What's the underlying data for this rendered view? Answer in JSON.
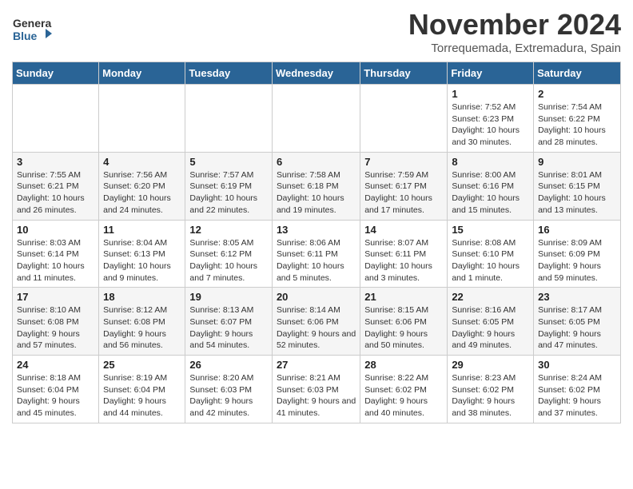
{
  "logo": {
    "line1": "General",
    "line2": "Blue"
  },
  "header": {
    "month": "November 2024",
    "location": "Torrequemada, Extremadura, Spain"
  },
  "weekdays": [
    "Sunday",
    "Monday",
    "Tuesday",
    "Wednesday",
    "Thursday",
    "Friday",
    "Saturday"
  ],
  "weeks": [
    [
      {
        "day": "",
        "info": ""
      },
      {
        "day": "",
        "info": ""
      },
      {
        "day": "",
        "info": ""
      },
      {
        "day": "",
        "info": ""
      },
      {
        "day": "",
        "info": ""
      },
      {
        "day": "1",
        "info": "Sunrise: 7:52 AM\nSunset: 6:23 PM\nDaylight: 10 hours and 30 minutes."
      },
      {
        "day": "2",
        "info": "Sunrise: 7:54 AM\nSunset: 6:22 PM\nDaylight: 10 hours and 28 minutes."
      }
    ],
    [
      {
        "day": "3",
        "info": "Sunrise: 7:55 AM\nSunset: 6:21 PM\nDaylight: 10 hours and 26 minutes."
      },
      {
        "day": "4",
        "info": "Sunrise: 7:56 AM\nSunset: 6:20 PM\nDaylight: 10 hours and 24 minutes."
      },
      {
        "day": "5",
        "info": "Sunrise: 7:57 AM\nSunset: 6:19 PM\nDaylight: 10 hours and 22 minutes."
      },
      {
        "day": "6",
        "info": "Sunrise: 7:58 AM\nSunset: 6:18 PM\nDaylight: 10 hours and 19 minutes."
      },
      {
        "day": "7",
        "info": "Sunrise: 7:59 AM\nSunset: 6:17 PM\nDaylight: 10 hours and 17 minutes."
      },
      {
        "day": "8",
        "info": "Sunrise: 8:00 AM\nSunset: 6:16 PM\nDaylight: 10 hours and 15 minutes."
      },
      {
        "day": "9",
        "info": "Sunrise: 8:01 AM\nSunset: 6:15 PM\nDaylight: 10 hours and 13 minutes."
      }
    ],
    [
      {
        "day": "10",
        "info": "Sunrise: 8:03 AM\nSunset: 6:14 PM\nDaylight: 10 hours and 11 minutes."
      },
      {
        "day": "11",
        "info": "Sunrise: 8:04 AM\nSunset: 6:13 PM\nDaylight: 10 hours and 9 minutes."
      },
      {
        "day": "12",
        "info": "Sunrise: 8:05 AM\nSunset: 6:12 PM\nDaylight: 10 hours and 7 minutes."
      },
      {
        "day": "13",
        "info": "Sunrise: 8:06 AM\nSunset: 6:11 PM\nDaylight: 10 hours and 5 minutes."
      },
      {
        "day": "14",
        "info": "Sunrise: 8:07 AM\nSunset: 6:11 PM\nDaylight: 10 hours and 3 minutes."
      },
      {
        "day": "15",
        "info": "Sunrise: 8:08 AM\nSunset: 6:10 PM\nDaylight: 10 hours and 1 minute."
      },
      {
        "day": "16",
        "info": "Sunrise: 8:09 AM\nSunset: 6:09 PM\nDaylight: 9 hours and 59 minutes."
      }
    ],
    [
      {
        "day": "17",
        "info": "Sunrise: 8:10 AM\nSunset: 6:08 PM\nDaylight: 9 hours and 57 minutes."
      },
      {
        "day": "18",
        "info": "Sunrise: 8:12 AM\nSunset: 6:08 PM\nDaylight: 9 hours and 56 minutes."
      },
      {
        "day": "19",
        "info": "Sunrise: 8:13 AM\nSunset: 6:07 PM\nDaylight: 9 hours and 54 minutes."
      },
      {
        "day": "20",
        "info": "Sunrise: 8:14 AM\nSunset: 6:06 PM\nDaylight: 9 hours and 52 minutes."
      },
      {
        "day": "21",
        "info": "Sunrise: 8:15 AM\nSunset: 6:06 PM\nDaylight: 9 hours and 50 minutes."
      },
      {
        "day": "22",
        "info": "Sunrise: 8:16 AM\nSunset: 6:05 PM\nDaylight: 9 hours and 49 minutes."
      },
      {
        "day": "23",
        "info": "Sunrise: 8:17 AM\nSunset: 6:05 PM\nDaylight: 9 hours and 47 minutes."
      }
    ],
    [
      {
        "day": "24",
        "info": "Sunrise: 8:18 AM\nSunset: 6:04 PM\nDaylight: 9 hours and 45 minutes."
      },
      {
        "day": "25",
        "info": "Sunrise: 8:19 AM\nSunset: 6:04 PM\nDaylight: 9 hours and 44 minutes."
      },
      {
        "day": "26",
        "info": "Sunrise: 8:20 AM\nSunset: 6:03 PM\nDaylight: 9 hours and 42 minutes."
      },
      {
        "day": "27",
        "info": "Sunrise: 8:21 AM\nSunset: 6:03 PM\nDaylight: 9 hours and 41 minutes."
      },
      {
        "day": "28",
        "info": "Sunrise: 8:22 AM\nSunset: 6:02 PM\nDaylight: 9 hours and 40 minutes."
      },
      {
        "day": "29",
        "info": "Sunrise: 8:23 AM\nSunset: 6:02 PM\nDaylight: 9 hours and 38 minutes."
      },
      {
        "day": "30",
        "info": "Sunrise: 8:24 AM\nSunset: 6:02 PM\nDaylight: 9 hours and 37 minutes."
      }
    ]
  ]
}
